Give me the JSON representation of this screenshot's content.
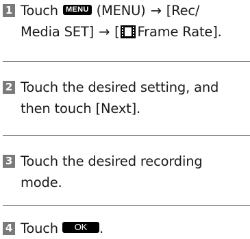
{
  "steps": [
    {
      "num": "1",
      "touch": "Touch",
      "menu_badge": "MENU",
      "menu_paren": "(MENU)",
      "arrow1": "→",
      "rec_part": "[Rec/",
      "media_part": "Media SET]",
      "arrow2": "→",
      "bracket_open": "[",
      "frame_rate": "Frame Rate].",
      "icon": "film-icon"
    },
    {
      "num": "2",
      "line1": "Touch the desired setting, and",
      "line2": "then touch [Next]."
    },
    {
      "num": "3",
      "line1": "Touch the desired recording",
      "line2": "mode."
    },
    {
      "num": "4",
      "touch": "Touch",
      "ok_badge": "OK",
      "period": "."
    }
  ],
  "colors": {
    "number_bg": "#7a7a7a",
    "number_text": "#ffffff",
    "badge_bg": "#000000",
    "divider": "#555555"
  }
}
